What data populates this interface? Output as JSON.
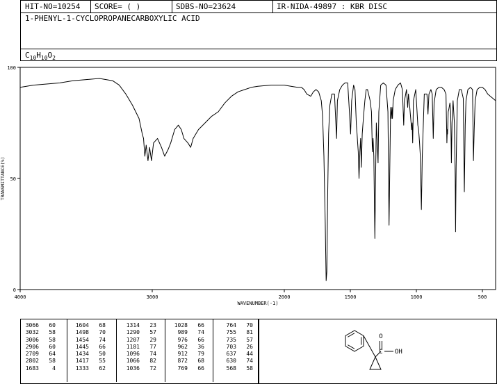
{
  "header": {
    "hit_no": "HIT-NO=10254",
    "score": "SCORE=  (   )",
    "sdbs_no": "SDBS-NO=23624",
    "ir_nida": "IR-NIDA-49897 : KBR DISC",
    "compound_name": "1-PHENYL-1-CYCLOPROPANECARBOXYLIC ACID",
    "formula": [
      {
        "t": "C",
        "sub": false
      },
      {
        "t": "10",
        "sub": true
      },
      {
        "t": "H",
        "sub": false
      },
      {
        "t": "10",
        "sub": true
      },
      {
        "t": "O",
        "sub": false
      },
      {
        "t": "2",
        "sub": true
      }
    ]
  },
  "chart_data": {
    "type": "line",
    "xlabel": "WAVENUMBER(-1)",
    "ylabel": "TRANSMITTANCE(%)",
    "xlim": [
      4000,
      400
    ],
    "ylim": [
      0,
      100
    ],
    "x_ticks": [
      4000,
      3000,
      2000,
      1500,
      1000,
      500
    ],
    "y_ticks": [
      0,
      50,
      100
    ],
    "series": [
      {
        "points": [
          [
            4000,
            91
          ],
          [
            3900,
            92
          ],
          [
            3800,
            92.5
          ],
          [
            3700,
            93
          ],
          [
            3600,
            94
          ],
          [
            3500,
            94.5
          ],
          [
            3400,
            95
          ],
          [
            3300,
            94
          ],
          [
            3250,
            92
          ],
          [
            3200,
            88
          ],
          [
            3150,
            83
          ],
          [
            3100,
            77
          ],
          [
            3075,
            70
          ],
          [
            3066,
            68
          ],
          [
            3056,
            60
          ],
          [
            3046,
            65
          ],
          [
            3032,
            58
          ],
          [
            3020,
            64
          ],
          [
            3006,
            58
          ],
          [
            2990,
            66
          ],
          [
            2960,
            68
          ],
          [
            2930,
            64
          ],
          [
            2906,
            60
          ],
          [
            2880,
            63
          ],
          [
            2860,
            66
          ],
          [
            2830,
            72
          ],
          [
            2802,
            74
          ],
          [
            2780,
            72
          ],
          [
            2760,
            68
          ],
          [
            2730,
            66
          ],
          [
            2709,
            64
          ],
          [
            2690,
            68
          ],
          [
            2650,
            72
          ],
          [
            2600,
            75
          ],
          [
            2550,
            78
          ],
          [
            2500,
            80
          ],
          [
            2450,
            84
          ],
          [
            2400,
            87
          ],
          [
            2350,
            89
          ],
          [
            2300,
            90
          ],
          [
            2250,
            91
          ],
          [
            2200,
            91.5
          ],
          [
            2100,
            92
          ],
          [
            2000,
            92
          ],
          [
            1950,
            91.5
          ],
          [
            1900,
            91
          ],
          [
            1870,
            91
          ],
          [
            1850,
            90
          ],
          [
            1830,
            88
          ],
          [
            1800,
            87
          ],
          [
            1780,
            89
          ],
          [
            1760,
            90
          ],
          [
            1740,
            89
          ],
          [
            1720,
            85
          ],
          [
            1710,
            78
          ],
          [
            1700,
            60
          ],
          [
            1690,
            30
          ],
          [
            1683,
            4
          ],
          [
            1678,
            8
          ],
          [
            1672,
            40
          ],
          [
            1665,
            70
          ],
          [
            1655,
            83
          ],
          [
            1640,
            88
          ],
          [
            1620,
            88
          ],
          [
            1604,
            68
          ],
          [
            1598,
            85
          ],
          [
            1580,
            90
          ],
          [
            1560,
            92
          ],
          [
            1540,
            93
          ],
          [
            1520,
            93
          ],
          [
            1507,
            80
          ],
          [
            1498,
            70
          ],
          [
            1490,
            85
          ],
          [
            1475,
            92
          ],
          [
            1465,
            90
          ],
          [
            1454,
            74
          ],
          [
            1449,
            70
          ],
          [
            1445,
            66
          ],
          [
            1440,
            62
          ],
          [
            1434,
            50
          ],
          [
            1428,
            62
          ],
          [
            1422,
            68
          ],
          [
            1417,
            55
          ],
          [
            1410,
            70
          ],
          [
            1400,
            78
          ],
          [
            1390,
            85
          ],
          [
            1380,
            90
          ],
          [
            1370,
            90
          ],
          [
            1350,
            85
          ],
          [
            1340,
            80
          ],
          [
            1333,
            62
          ],
          [
            1328,
            68
          ],
          [
            1322,
            60
          ],
          [
            1318,
            40
          ],
          [
            1314,
            23
          ],
          [
            1309,
            50
          ],
          [
            1303,
            75
          ],
          [
            1296,
            65
          ],
          [
            1290,
            57
          ],
          [
            1284,
            80
          ],
          [
            1270,
            92
          ],
          [
            1250,
            93
          ],
          [
            1230,
            92
          ],
          [
            1215,
            80
          ],
          [
            1207,
            29
          ],
          [
            1200,
            60
          ],
          [
            1195,
            82
          ],
          [
            1190,
            77
          ],
          [
            1185,
            82
          ],
          [
            1181,
            77
          ],
          [
            1176,
            85
          ],
          [
            1160,
            90
          ],
          [
            1140,
            92
          ],
          [
            1120,
            93
          ],
          [
            1106,
            90
          ],
          [
            1096,
            74
          ],
          [
            1090,
            85
          ],
          [
            1075,
            90
          ],
          [
            1066,
            82
          ],
          [
            1060,
            88
          ],
          [
            1050,
            82
          ],
          [
            1036,
            72
          ],
          [
            1032,
            75
          ],
          [
            1028,
            66
          ],
          [
            1022,
            85
          ],
          [
            1005,
            90
          ],
          [
            995,
            80
          ],
          [
            989,
            74
          ],
          [
            983,
            72
          ],
          [
            976,
            66
          ],
          [
            970,
            60
          ],
          [
            962,
            36
          ],
          [
            955,
            60
          ],
          [
            940,
            88
          ],
          [
            920,
            88
          ],
          [
            912,
            79
          ],
          [
            905,
            88
          ],
          [
            890,
            90
          ],
          [
            880,
            88
          ],
          [
            872,
            68
          ],
          [
            866,
            84
          ],
          [
            850,
            90
          ],
          [
            830,
            91
          ],
          [
            810,
            91
          ],
          [
            790,
            90
          ],
          [
            776,
            88
          ],
          [
            769,
            66
          ],
          [
            766,
            72
          ],
          [
            764,
            70
          ],
          [
            759,
            80
          ],
          [
            755,
            81
          ],
          [
            746,
            84
          ],
          [
            740,
            80
          ],
          [
            735,
            57
          ],
          [
            730,
            75
          ],
          [
            722,
            85
          ],
          [
            712,
            75
          ],
          [
            706,
            50
          ],
          [
            703,
            26
          ],
          [
            699,
            55
          ],
          [
            690,
            85
          ],
          [
            675,
            90
          ],
          [
            660,
            90
          ],
          [
            645,
            86
          ],
          [
            637,
            44
          ],
          [
            633,
            60
          ],
          [
            630,
            74
          ],
          [
            624,
            85
          ],
          [
            610,
            90
          ],
          [
            590,
            91
          ],
          [
            575,
            90
          ],
          [
            568,
            58
          ],
          [
            562,
            72
          ],
          [
            555,
            85
          ],
          [
            540,
            90
          ],
          [
            520,
            91
          ],
          [
            500,
            91
          ],
          [
            480,
            90
          ],
          [
            460,
            88
          ],
          [
            440,
            87
          ],
          [
            420,
            86
          ],
          [
            400,
            85
          ]
        ]
      }
    ],
    "peak_table": [
      [
        [
          3066,
          60
        ],
        [
          3032,
          58
        ],
        [
          3006,
          58
        ],
        [
          2906,
          60
        ],
        [
          2709,
          64
        ],
        [
          2802,
          58
        ],
        [
          1683,
          4
        ]
      ],
      [
        [
          1604,
          68
        ],
        [
          1498,
          70
        ],
        [
          1454,
          74
        ],
        [
          1445,
          66
        ],
        [
          1434,
          50
        ],
        [
          1417,
          55
        ],
        [
          1333,
          62
        ]
      ],
      [
        [
          1314,
          23
        ],
        [
          1290,
          57
        ],
        [
          1207,
          29
        ],
        [
          1181,
          77
        ],
        [
          1096,
          74
        ],
        [
          1066,
          82
        ],
        [
          1036,
          72
        ]
      ],
      [
        [
          1028,
          66
        ],
        [
          989,
          74
        ],
        [
          976,
          66
        ],
        [
          962,
          36
        ],
        [
          912,
          79
        ],
        [
          872,
          68
        ],
        [
          769,
          66
        ]
      ],
      [
        [
          764,
          70
        ],
        [
          755,
          81
        ],
        [
          735,
          57
        ],
        [
          703,
          26
        ],
        [
          637,
          44
        ],
        [
          630,
          74
        ],
        [
          568,
          58
        ]
      ]
    ]
  },
  "structure": {
    "atom_label": "O",
    "group_label": "OH",
    "carbon_label": "C"
  }
}
